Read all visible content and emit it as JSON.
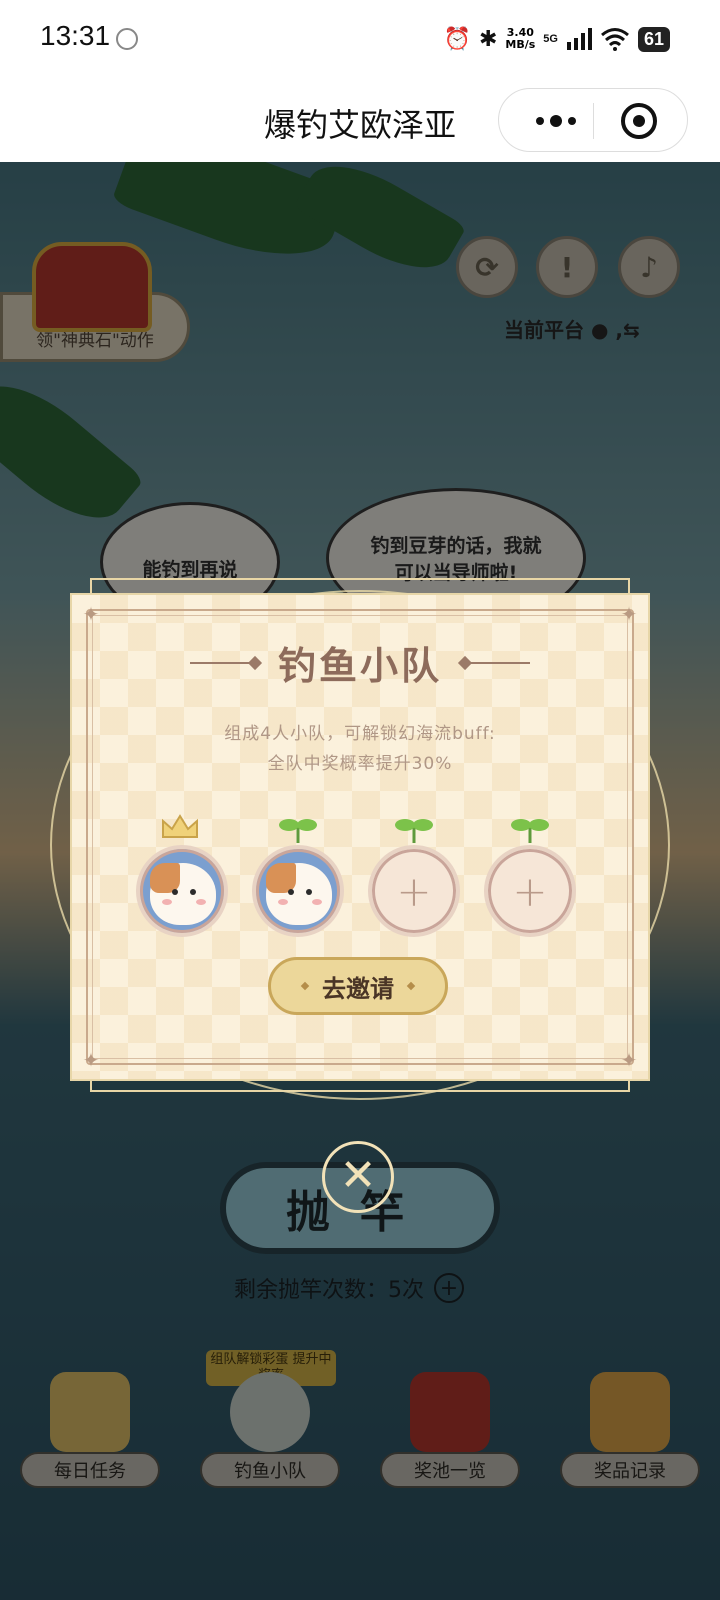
{
  "status_bar": {
    "time": "13:31",
    "speed_value": "3.40",
    "speed_unit": "MB/s",
    "network": "5G",
    "battery": "61"
  },
  "header": {
    "title": "爆钓艾欧泽亚"
  },
  "game": {
    "chest_label": "领\"神典石\"动作",
    "platform_label": "当前平台",
    "bubble_left": "能钓到再说",
    "bubble_right": "钓到豆芽的话，我就可以当导师啦!",
    "cast_button": "抛竿",
    "remaining_label": "剩余抛竿次数：5次",
    "team_hint": "组队解锁彩蛋 提升中奖率",
    "nav": [
      {
        "label": "每日任务",
        "icon": "daily-task-icon"
      },
      {
        "label": "钓鱼小队",
        "icon": "team-icon"
      },
      {
        "label": "奖池一览",
        "icon": "gift-box-icon"
      },
      {
        "label": "奖品记录",
        "icon": "record-book-icon"
      }
    ]
  },
  "modal": {
    "title": "钓鱼小队",
    "desc_line1": "组成4人小队，可解锁幻海流buff:",
    "desc_line2": "全队中奖概率提升30%",
    "members": [
      {
        "type": "leader",
        "filled": true
      },
      {
        "type": "member",
        "filled": true
      },
      {
        "type": "empty",
        "filled": false
      },
      {
        "type": "empty",
        "filled": false
      }
    ],
    "invite_button": "去邀请"
  }
}
